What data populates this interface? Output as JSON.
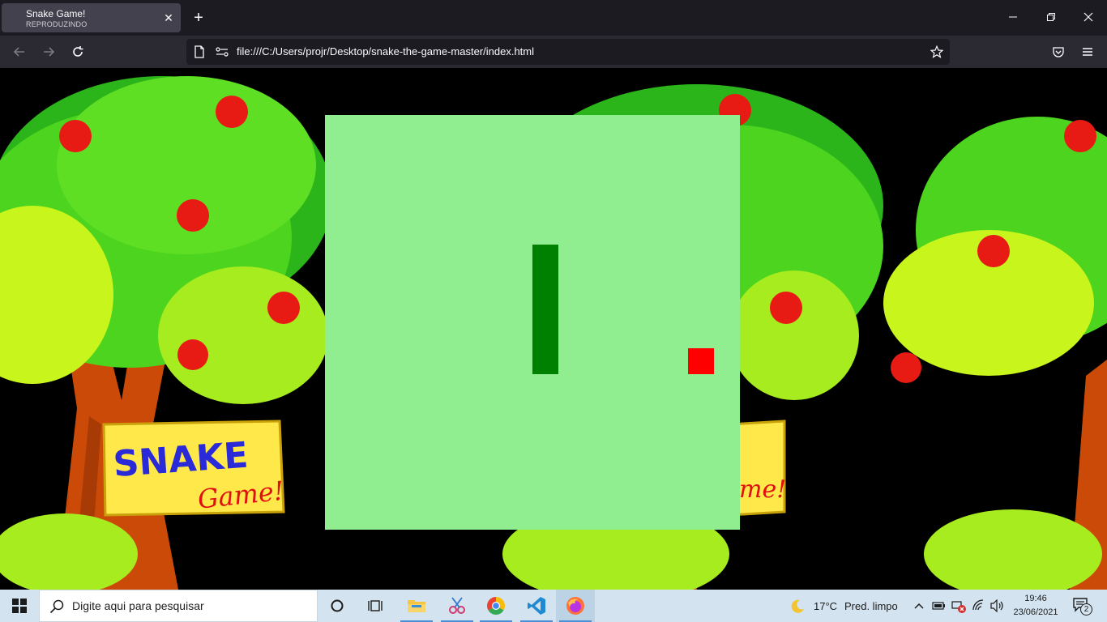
{
  "browser": {
    "tab": {
      "title": "Snake Game!",
      "subtitle": "REPRODUZINDO"
    },
    "url": "file:///C:/Users/projr/Desktop/snake-the-game-master/index.html"
  },
  "background": {
    "sign": {
      "line1": "SNAKE",
      "line2": "Game!",
      "partial": "me!"
    }
  },
  "game": {
    "canvas_color": "#90ee90",
    "snake_color": "#008000",
    "food_color": "#ff0000"
  },
  "taskbar": {
    "search_placeholder": "Digite aqui para pesquisar",
    "weather": {
      "temp": "17°C",
      "desc": "Pred. limpo"
    },
    "clock": {
      "time": "19:46",
      "date": "23/06/2021"
    },
    "notifications": "2"
  }
}
